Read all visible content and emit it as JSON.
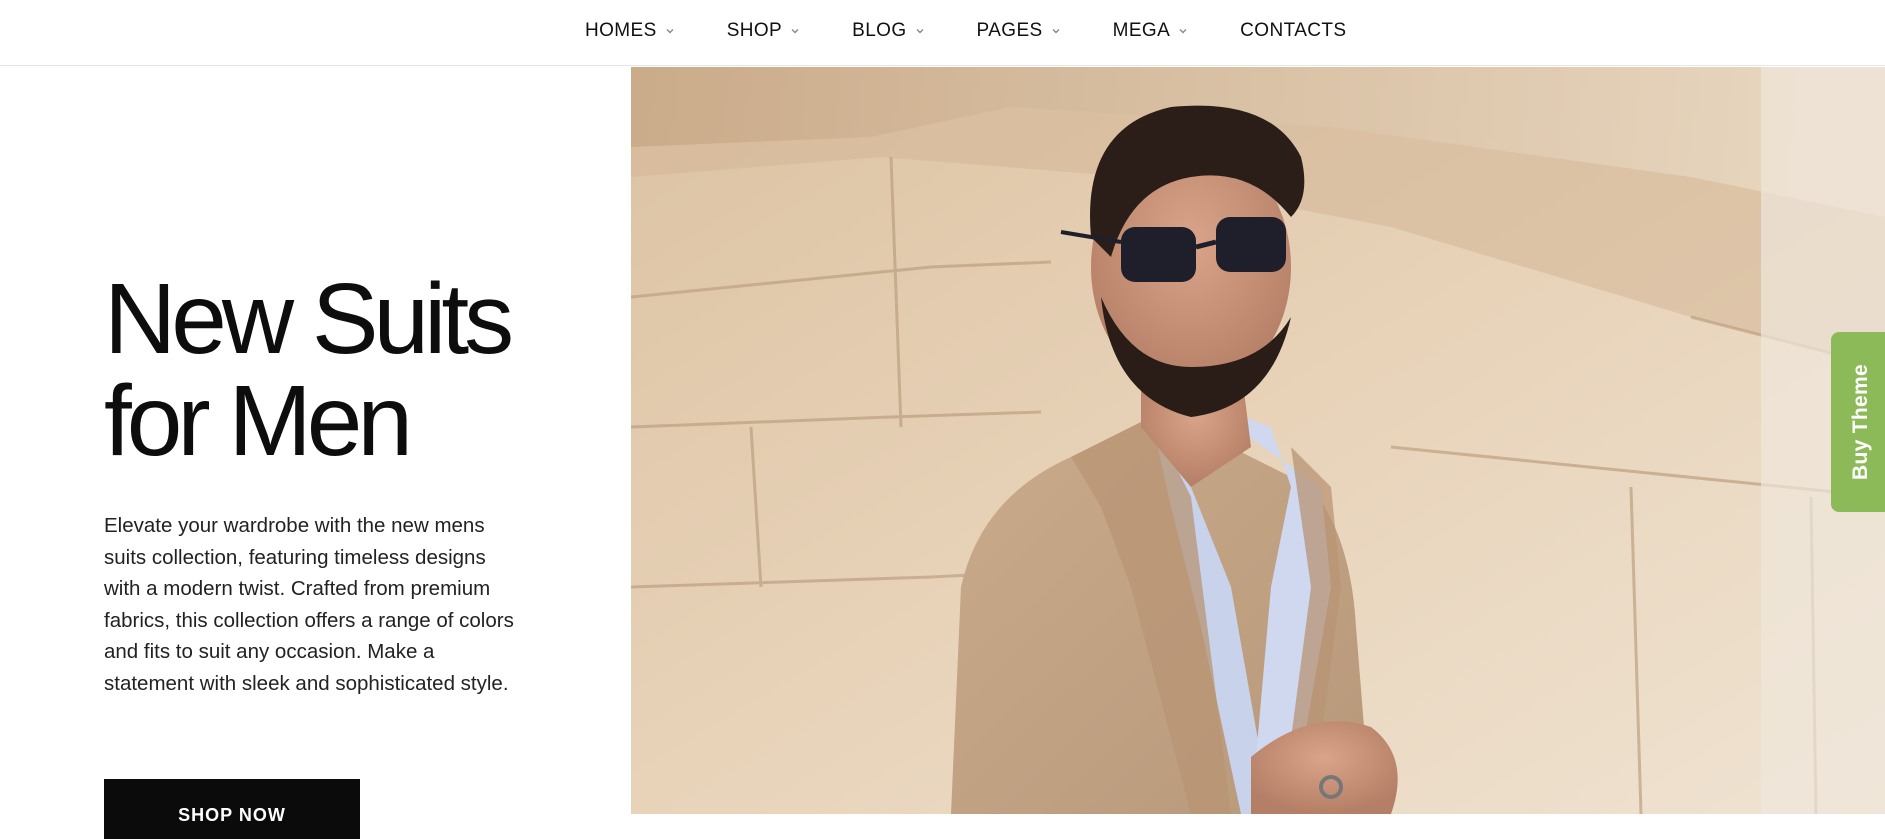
{
  "nav": {
    "items": [
      {
        "label": "HOMES",
        "has_dropdown": true
      },
      {
        "label": "SHOP",
        "has_dropdown": true
      },
      {
        "label": "BLOG",
        "has_dropdown": true
      },
      {
        "label": "PAGES",
        "has_dropdown": true
      },
      {
        "label": "MEGA",
        "has_dropdown": true
      },
      {
        "label": "CONTACTS",
        "has_dropdown": false
      }
    ]
  },
  "hero": {
    "title_line1": "New Suits",
    "title_line2": "for Men",
    "description": "Elevate your wardrobe with the new mens suits collection, featuring timeless designs with a modern twist. Crafted from premium fabrics, this collection offers a range of colors and fits to suit any occasion. Make a statement with sleek and sophisticated style.",
    "cta_label": "SHOP NOW"
  },
  "buy_theme": {
    "label": "Buy Theme"
  },
  "icons": {
    "dropdown": "chevron-down-icon"
  },
  "colors": {
    "button_bg": "#0b0b0b",
    "buy_theme_bg": "#8cba58",
    "text": "#111111"
  }
}
